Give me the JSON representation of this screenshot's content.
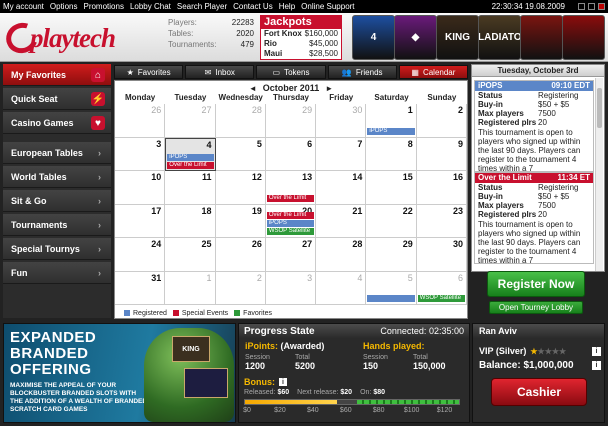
{
  "menu": [
    "My account",
    "Options",
    "Promotions",
    "Lobby Chat",
    "Search Player",
    "Contact Us",
    "Help",
    "Online Support"
  ],
  "clock": "22:30:34 19.08.2009",
  "brand": "playtech",
  "stats": [
    {
      "label": "Players:",
      "value": "22283"
    },
    {
      "label": "Tables:",
      "value": "2020"
    },
    {
      "label": "Tournaments:",
      "value": "479"
    }
  ],
  "jackpots": {
    "title": "Jackpots",
    "rows": [
      {
        "name": "Fort Knox",
        "amount": "$160,000"
      },
      {
        "name": "Rio",
        "amount": "$45,000"
      },
      {
        "name": "Maui",
        "amount": "$28,500"
      }
    ]
  },
  "games": [
    {
      "label": "4",
      "color": "#1d4fa0"
    },
    {
      "label": "◆",
      "color": "#6a1a7a"
    },
    {
      "label": "KING",
      "color": "#3a2a1a"
    },
    {
      "label": "GLADIATOR",
      "color": "#4a3a22"
    },
    {
      "label": "",
      "color": "#7a1410"
    },
    {
      "label": "",
      "color": "#8a0c0c"
    }
  ],
  "nav": [
    {
      "label": "My Favorites",
      "icon": "home-icon",
      "glyph": "⌂",
      "active": true
    },
    {
      "label": "Quick Seat",
      "icon": "quick-seat-icon",
      "glyph": "⚡",
      "active": false
    },
    {
      "label": "Casino Games",
      "icon": "cards-icon",
      "glyph": "♥",
      "active": false
    },
    {
      "label": "European Tables",
      "active": false
    },
    {
      "label": "World Tables",
      "active": false
    },
    {
      "label": "Sit & Go",
      "active": false
    },
    {
      "label": "Tournaments",
      "active": false
    },
    {
      "label": "Special Tournys",
      "active": false
    },
    {
      "label": "Fun",
      "active": false
    }
  ],
  "tabs": [
    {
      "label": "Favorites",
      "glyph": "★",
      "icon": "star-icon",
      "active": false
    },
    {
      "label": "Inbox",
      "glyph": "✉",
      "icon": "envelope-icon",
      "active": false
    },
    {
      "label": "Tokens",
      "glyph": "▭",
      "icon": "token-icon",
      "active": false
    },
    {
      "label": "Friends",
      "glyph": "👥",
      "icon": "friends-icon",
      "active": false
    },
    {
      "label": "Calendar",
      "glyph": "▦",
      "icon": "calendar-icon",
      "active": true
    }
  ],
  "calendar": {
    "month": "October 2011",
    "days": [
      "Monday",
      "Tuesday",
      "Wednesday",
      "Thursday",
      "Friday",
      "Saturday",
      "Sunday"
    ],
    "weeks": [
      [
        {
          "d": "26",
          "o": true
        },
        {
          "d": "27",
          "o": true
        },
        {
          "d": "28",
          "o": true
        },
        {
          "d": "29",
          "o": true
        },
        {
          "d": "30",
          "o": true
        },
        {
          "d": "1",
          "ev": [
            {
              "t": "iPOPS",
              "c": "blue"
            }
          ]
        },
        {
          "d": "2"
        }
      ],
      [
        {
          "d": "3"
        },
        {
          "d": "4",
          "sel": true,
          "ev": [
            {
              "t": "iPOPS",
              "c": "blue"
            },
            {
              "t": "Over the Limit",
              "c": "red"
            }
          ]
        },
        {
          "d": "5"
        },
        {
          "d": "6"
        },
        {
          "d": "7"
        },
        {
          "d": "8"
        },
        {
          "d": "9"
        }
      ],
      [
        {
          "d": "10"
        },
        {
          "d": "11"
        },
        {
          "d": "12"
        },
        {
          "d": "13",
          "ev": [
            {
              "t": "Over the Limit",
              "c": "red"
            }
          ]
        },
        {
          "d": "14"
        },
        {
          "d": "15"
        },
        {
          "d": "16"
        }
      ],
      [
        {
          "d": "17"
        },
        {
          "d": "18"
        },
        {
          "d": "19"
        },
        {
          "d": "20",
          "ev": [
            {
              "t": "Over the Limit",
              "c": "red"
            },
            {
              "t": "iPOPS",
              "c": "blue"
            },
            {
              "t": "WSOP Satellite",
              "c": "green"
            }
          ]
        },
        {
          "d": "21"
        },
        {
          "d": "22"
        },
        {
          "d": "23"
        }
      ],
      [
        {
          "d": "24"
        },
        {
          "d": "25"
        },
        {
          "d": "26"
        },
        {
          "d": "27"
        },
        {
          "d": "28"
        },
        {
          "d": "29"
        },
        {
          "d": "30"
        }
      ],
      [
        {
          "d": "31"
        },
        {
          "d": "1",
          "o": true
        },
        {
          "d": "2",
          "o": true
        },
        {
          "d": "3",
          "o": true
        },
        {
          "d": "4",
          "o": true
        },
        {
          "d": "5",
          "o": true,
          "ev": [
            {
              "t": "",
              "c": "blue"
            }
          ]
        },
        {
          "d": "6",
          "o": true,
          "ev": [
            {
              "t": "WSOP Satellite",
              "c": "green"
            }
          ]
        }
      ]
    ],
    "legend": [
      {
        "label": "Registered",
        "color": "#5b86c8"
      },
      {
        "label": "Special Events",
        "color": "#c8102e"
      },
      {
        "label": "Favorites",
        "color": "#2e9a3a"
      }
    ]
  },
  "right_panel": {
    "date": "Tuesday, October 3rd",
    "cards": [
      {
        "name": "iPOPS",
        "time": "09:10 EDT",
        "color": "blue",
        "status": "Registering",
        "buyin": "$50 + $5",
        "maxplayers": "7500",
        "registered": "20",
        "desc": "This tournament is open to players who signed up within the last 90 days. Players can register to the tournament 4 times within a 7"
      },
      {
        "name": "Over the Limit",
        "time": "11:34 ET",
        "color": "red",
        "status": "Registering",
        "buyin": "$50 + $5",
        "maxplayers": "7500",
        "registered": "20",
        "desc": "This tournament is open to players who signed up within the last 90 days. Players can register to the tournament 4 times within a 7"
      }
    ],
    "labels": {
      "status": "Status",
      "buyin": "Buy-in",
      "maxplayers": "Max players",
      "registered": "Registered plrs"
    }
  },
  "register_label": "Register Now",
  "lobby_label": "Open Tourney Lobby",
  "banner": {
    "headline1": "EXPANDED",
    "headline2": "BRANDED",
    "headline3": "OFFERING",
    "body": "MAXIMISE THE APPEAL OF YOUR BLOCKBUSTER BRANDED SLOTS WITH THE ADDITION OF A WEALTH OF BRANDED SCRATCH CARD GAMES",
    "card": "KING"
  },
  "progress": {
    "title": "Progress State",
    "connected_label": "Connected:",
    "connected": "02:35:00",
    "ipoints_label": "iPoints:",
    "ipoints_state": "(Awarded)",
    "ipoints_session": "1200",
    "ipoints_total": "5200",
    "hands_label": "Hands played:",
    "hands_session": "150",
    "hands_total": "150,000",
    "session_label": "Session",
    "total_label": "Total",
    "bonus_label": "Bonus:",
    "released_label": "Released:",
    "released": "$60",
    "next_label": "Next release:",
    "next": "$20",
    "on_label": "On:",
    "on": "$80",
    "released_value": 60,
    "next_value": 80,
    "scale_max": 140,
    "ticks": [
      "$0",
      "$20",
      "$40",
      "$60",
      "$80",
      "$100",
      "$120"
    ]
  },
  "account": {
    "name": "Ran Aviv",
    "vip": "VIP (Silver)",
    "stars_on": 1,
    "stars_total": 5,
    "balance_label": "Balance:",
    "balance": "$1,000,000",
    "cashier": "Cashier"
  }
}
